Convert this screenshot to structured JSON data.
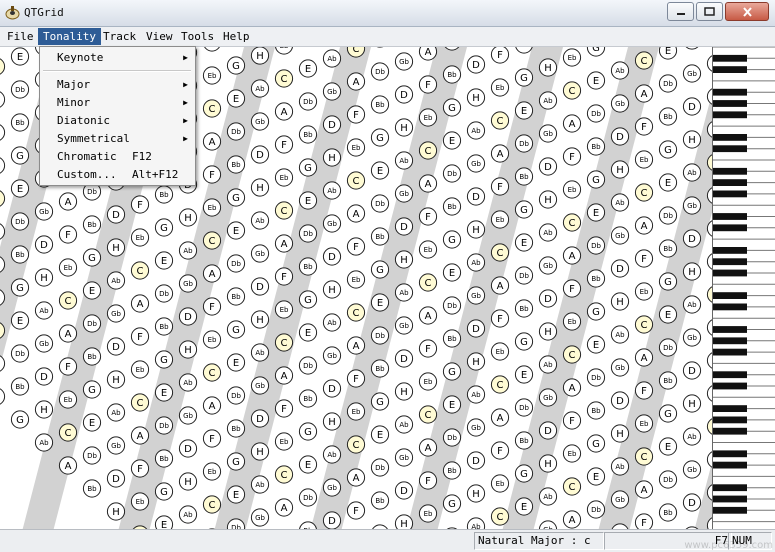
{
  "window": {
    "title": "QTGrid"
  },
  "menubar": {
    "items": [
      "File",
      "Tonality",
      "Track",
      "View",
      "Tools",
      "Help"
    ],
    "active": "Tonality"
  },
  "tonality_menu": {
    "items": [
      {
        "label": "Keynote",
        "submenu": true
      },
      {
        "separator": true
      },
      {
        "label": "Major",
        "submenu": true
      },
      {
        "label": "Minor",
        "submenu": true
      },
      {
        "label": "Diatonic",
        "submenu": true
      },
      {
        "label": "Symmetrical",
        "submenu": true
      },
      {
        "label": "Chromatic",
        "shortcut": "F12"
      },
      {
        "label": "Custom...",
        "shortcut": "Alt+F12"
      }
    ]
  },
  "grid": {
    "note_cycle": [
      "C",
      "G",
      "D",
      "A",
      "E",
      "H",
      "F",
      "Db",
      "Ab",
      "Eb",
      "Bb",
      "Gb"
    ],
    "tonic": "C",
    "colors": {
      "tonic_fill": "#fffbd4",
      "note_fill": "#ffffff",
      "stripe": "#d2d2d2",
      "circle_stroke": "#222222"
    }
  },
  "statusbar": {
    "tonality": "Natural Major : c",
    "key_hint": "F7",
    "indicator": "NUM"
  },
  "watermark": "www.pc6359.com"
}
